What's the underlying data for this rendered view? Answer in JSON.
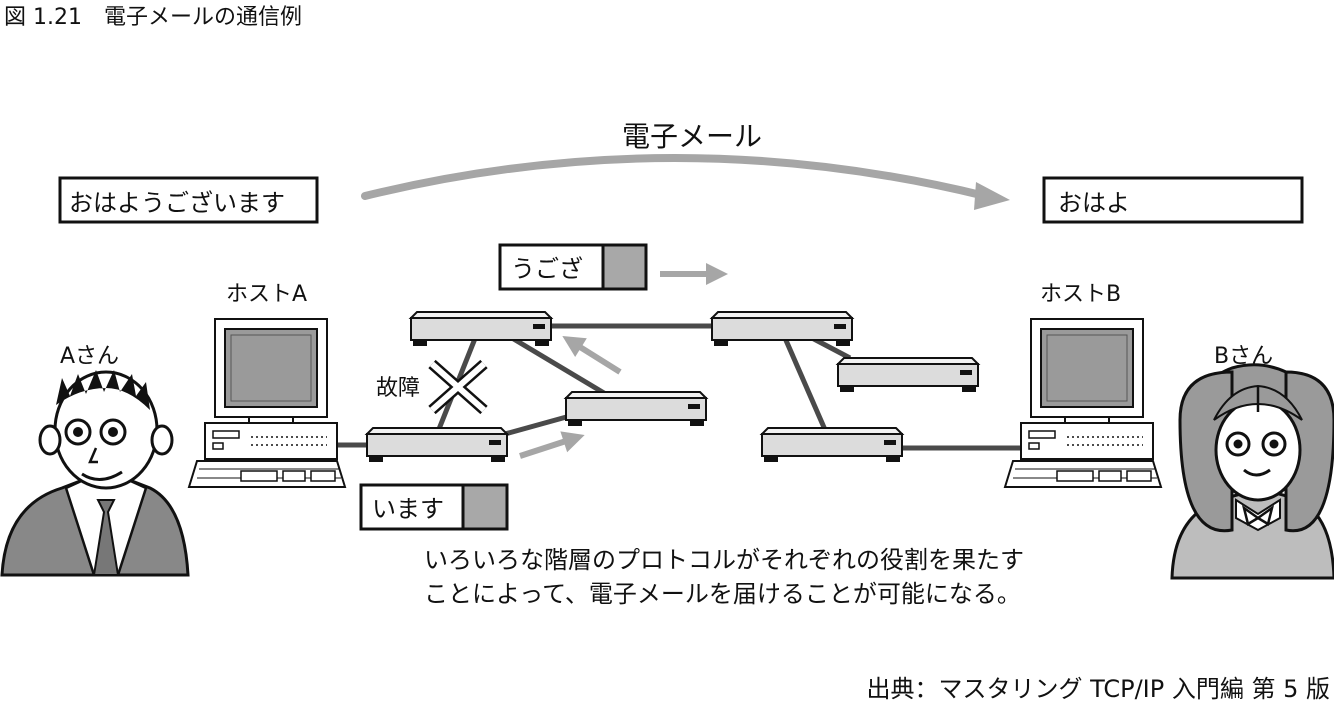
{
  "figure": {
    "caption": "図 1.21　電子メールの通信例",
    "source": "出典：マスタリング TCP/IP 入門編 第 5 版"
  },
  "diagram": {
    "arc_label": "電子メール",
    "message_sent": "おはようございます",
    "message_received": "おはよ",
    "packet_top": "うござ",
    "packet_bottom": "います",
    "host_a_label": "ホストA",
    "host_b_label": "ホストB",
    "person_a_label": "Aさん",
    "person_b_label": "Bさん",
    "failure_label": "故障",
    "note_line1": "いろいろな階層のプロトコルがそれぞれの役割を果たす",
    "note_line2": "ことによって、電子メールを届けることが可能になる。"
  },
  "colors": {
    "arrow_gray": "#a6a6a6",
    "link_dark": "#4a4a4a",
    "router_fill": "#dcdcdc",
    "screen_gray": "#9a9a9a",
    "packet_tail": "#a8a8a8"
  }
}
